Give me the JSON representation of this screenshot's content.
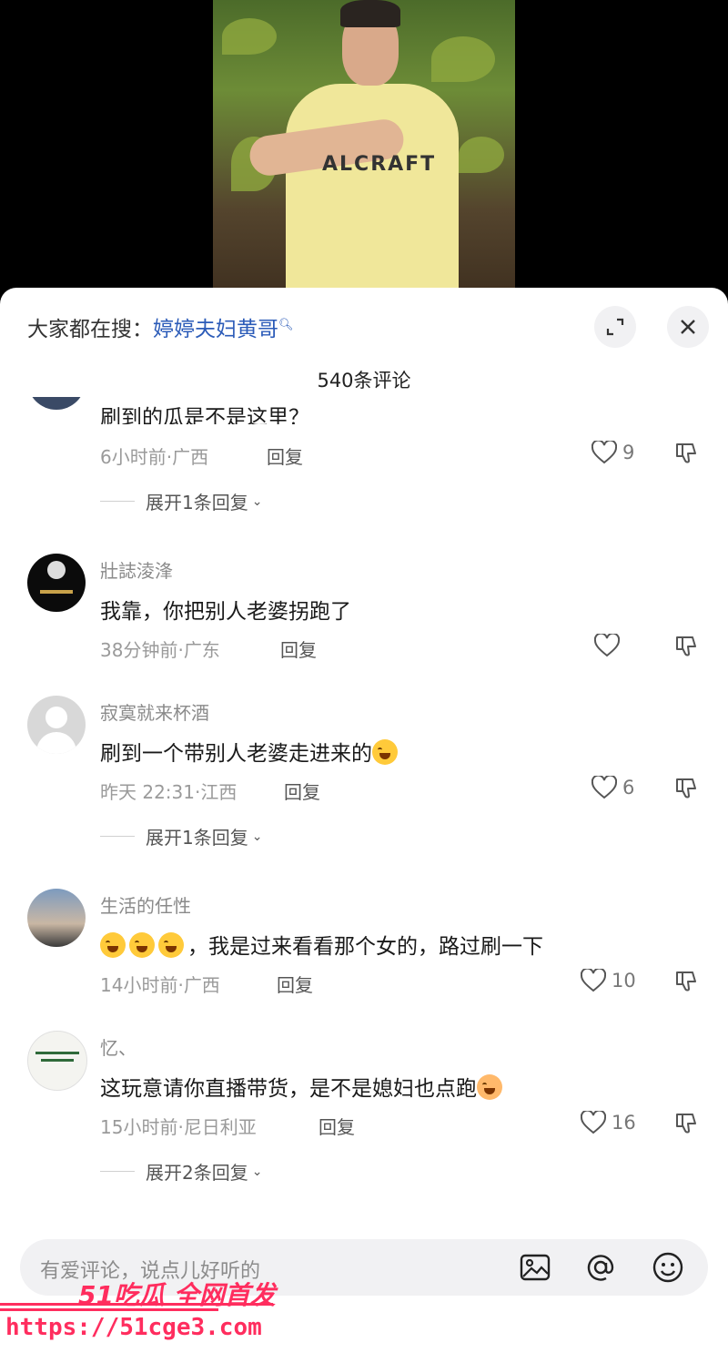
{
  "search": {
    "prefix": "大家都在搜：",
    "term": "婷婷夫妇黄哥"
  },
  "header": {
    "comment_count_label": "540条评论"
  },
  "comments": [
    {
      "username": "",
      "text": "刷到的瓜是不是这里？",
      "time": "6小时前",
      "location": "广西",
      "reply_label": "回复",
      "likes": "9",
      "expand_label": "展开1条回复"
    },
    {
      "username": "壯誌淩浲",
      "text": "我靠，你把别人老婆拐跑了",
      "time": "38分钟前",
      "location": "广东",
      "reply_label": "回复",
      "likes": ""
    },
    {
      "username": "寂寞就来杯酒",
      "text": "刷到一个带别人老婆走进来的",
      "time": "昨天 22:31",
      "location": "江西",
      "reply_label": "回复",
      "likes": "6",
      "expand_label": "展开1条回复"
    },
    {
      "username": "生活的任性",
      "text": "，我是过来看看那个女的，路过刷一下",
      "time": "14小时前",
      "location": "广西",
      "reply_label": "回复",
      "likes": "10"
    },
    {
      "username": "忆、",
      "text": "这玩意请你直播带货，是不是媳妇也点跑",
      "time": "15小时前",
      "location": "尼日利亚",
      "reply_label": "回复",
      "likes": "16",
      "expand_label": "展开2条回复"
    }
  ],
  "input": {
    "placeholder": "有爱评论，说点儿好听的"
  },
  "video": {
    "shirt_text": "ALCRAFT"
  },
  "watermark": {
    "brand": "51吃瓜 全网首发",
    "url": "https://51cge3.com"
  },
  "icons": [
    "search-icon",
    "expand-icon",
    "close-icon",
    "heart-icon",
    "dislike-icon",
    "image-icon",
    "mention-icon",
    "emoji-icon"
  ],
  "colors": {
    "link": "#2b5bb8",
    "watermark": "#ff2d5e",
    "sheet": "#ffffff"
  }
}
